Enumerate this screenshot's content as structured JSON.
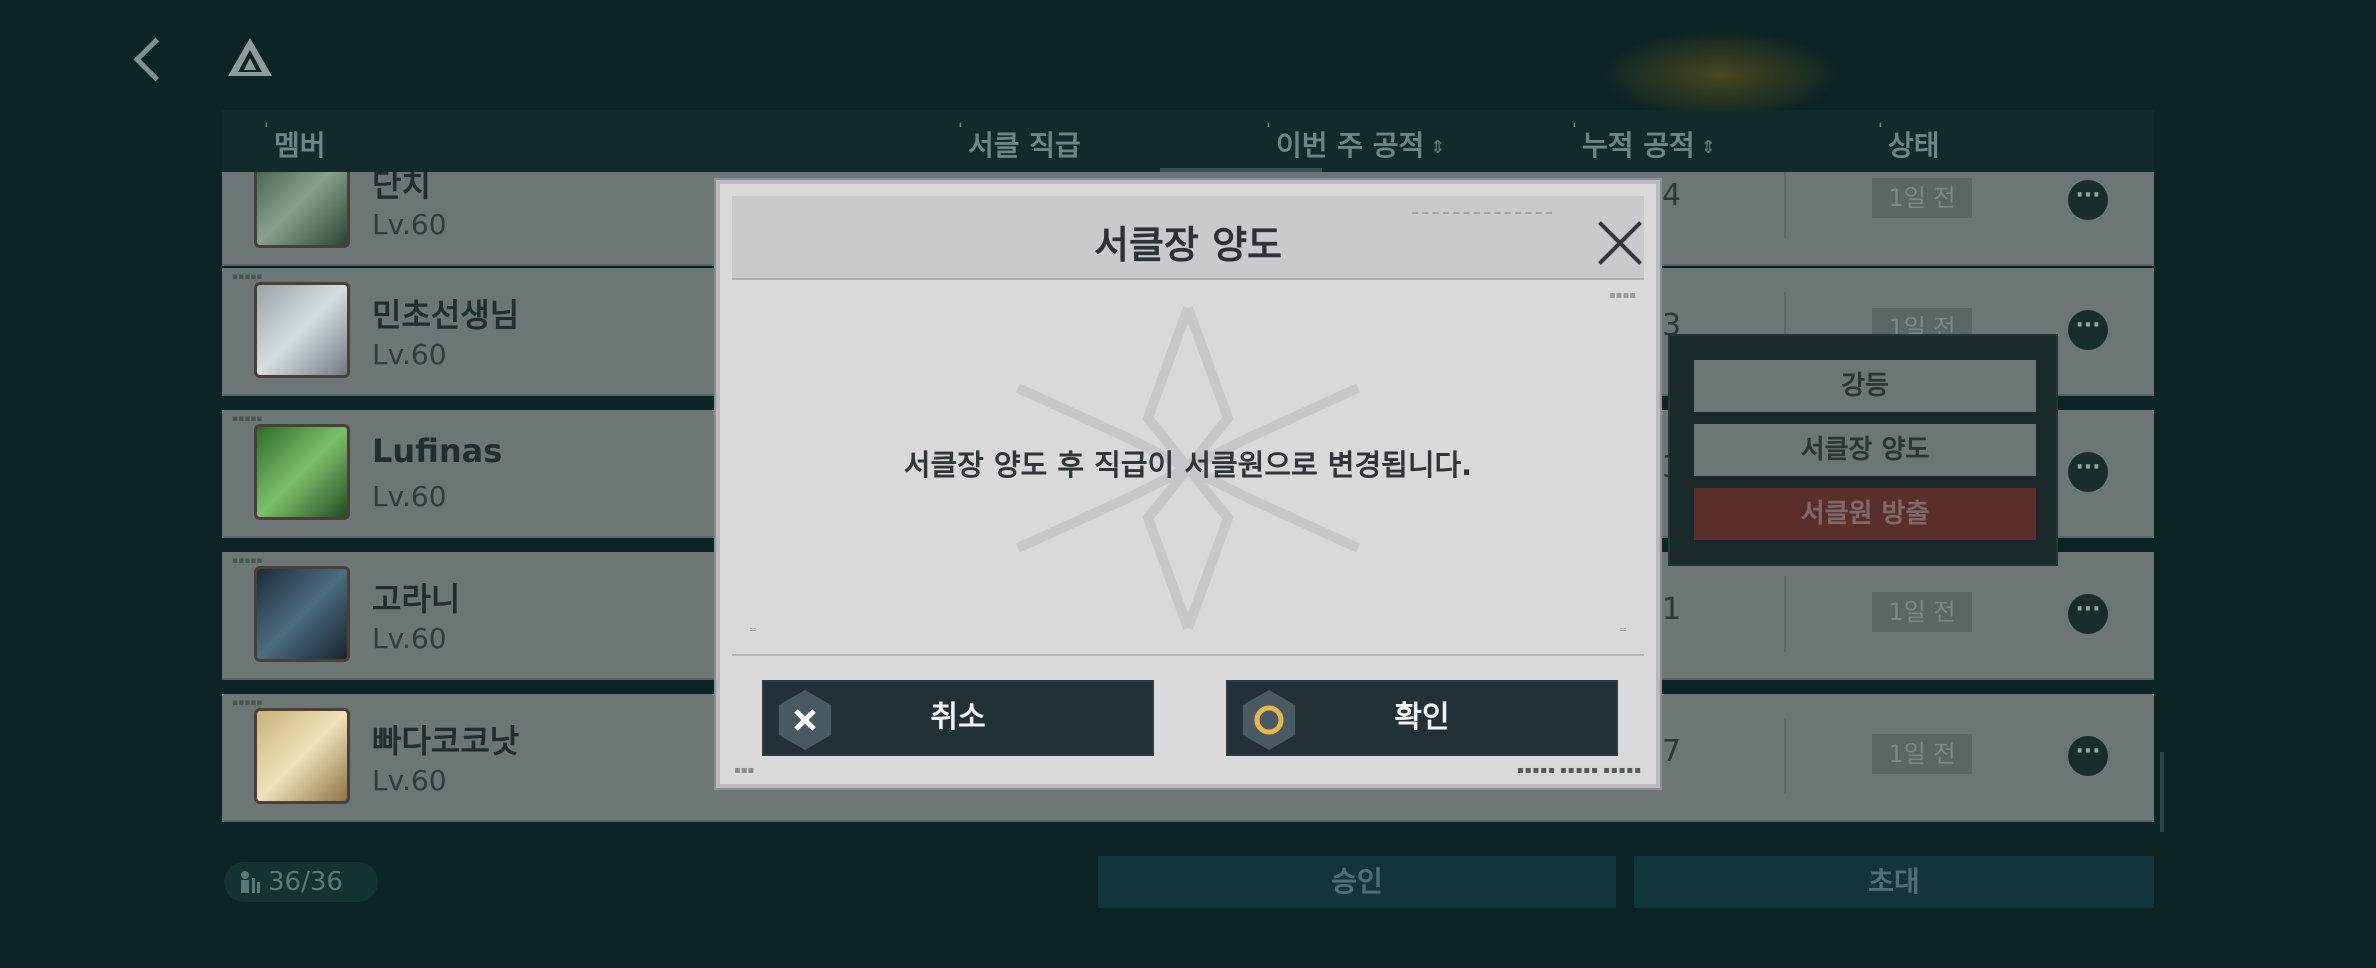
{
  "header": {
    "back_icon": "chevron-left-icon",
    "logo_icon": "triangle-logo-icon"
  },
  "table": {
    "columns": [
      {
        "label": "멤버",
        "sortable": false
      },
      {
        "label": "서클 직급",
        "sortable": false
      },
      {
        "label": "이번 주 공적",
        "sortable": true
      },
      {
        "label": "누적 공적",
        "sortable": true
      },
      {
        "label": "상태",
        "sortable": false
      }
    ],
    "rows": [
      {
        "name": "단치",
        "level": "Lv.60",
        "score": "4",
        "status": "1일 전"
      },
      {
        "name": "민초선생님",
        "level": "Lv.60",
        "score": "3",
        "status": "1일 전"
      },
      {
        "name": "Lufinas",
        "level": "Lv.60",
        "score": "3",
        "status": ""
      },
      {
        "name": "고라니",
        "level": "Lv.60",
        "score": "1",
        "status": "1일 전"
      },
      {
        "name": "빠다코코낫",
        "level": "Lv.60",
        "score": "7",
        "status": "1일 전"
      }
    ]
  },
  "context_menu": {
    "items": [
      {
        "label": "강등"
      },
      {
        "label": "서클장 양도"
      },
      {
        "label": "서클원 방출"
      }
    ]
  },
  "footer": {
    "member_count": "36/36",
    "approve_label": "승인",
    "invite_label": "초대"
  },
  "modal": {
    "title": "서클장 양도",
    "message": "서클장 양도 후 직급이 서클원으로 변경됩니다.",
    "cancel_label": "취소",
    "confirm_label": "확인",
    "colors": {
      "button_bg": "#233037",
      "confirm_ring": "#e6b84a",
      "dialog_bg": "#d9d9dc"
    }
  }
}
